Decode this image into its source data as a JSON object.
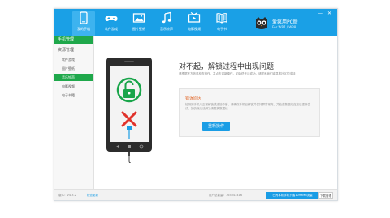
{
  "nav": [
    {
      "label": "我的手机",
      "icon": "phone-icon",
      "active": true
    },
    {
      "label": "软件游戏",
      "icon": "gamepad-icon",
      "active": false
    },
    {
      "label": "图片壁纸",
      "icon": "image-icon",
      "active": false
    },
    {
      "label": "音乐铃声",
      "icon": "music-icon",
      "active": false
    },
    {
      "label": "电影视频",
      "icon": "video-icon",
      "active": false
    },
    {
      "label": "电子书",
      "icon": "book-icon",
      "active": false
    }
  ],
  "brand": {
    "name": "爱疯用PC版",
    "subtitle": "For WP7 / WP8"
  },
  "window_controls": {
    "minimize": "—",
    "close": "✕"
  },
  "sidebar": {
    "header": "手机管理",
    "group": "资源管理",
    "items": [
      {
        "label": "软件游戏",
        "active": false
      },
      {
        "label": "图片壁纸",
        "active": false
      },
      {
        "label": "音乐铃声",
        "active": true
      },
      {
        "label": "电影视频",
        "active": false
      },
      {
        "label": "电子书籍",
        "active": false
      }
    ]
  },
  "main": {
    "title": "对不起，解锁过程中出现问题",
    "description": "请根据下方信息检查操作，并点击重新操作，如始终无法成功，请联系我们或寻求社区的支持",
    "error": {
      "title": "错误原因",
      "body": "检测到手机未正常解锁或连接中断，请确保手机已解锁并保持屏幕常亮，并检查数据线连接后重新尝试，如仍然无法解决请更换数据线"
    },
    "retry_label": "重新操作"
  },
  "status": {
    "version": "版本：V4.3.2",
    "check_update": "检查更新",
    "user_count": "用户总数量：165343416",
    "notice": "已为本机手机节省1099MB流量",
    "button": "下载管理"
  },
  "colors": {
    "topbar": "#1aa0e6",
    "sidebar_active": "#1fa84b",
    "error_text": "#e26a2c",
    "button": "#1a9de5",
    "lock_green": "#19a54a",
    "cross_red": "#e0322b"
  }
}
